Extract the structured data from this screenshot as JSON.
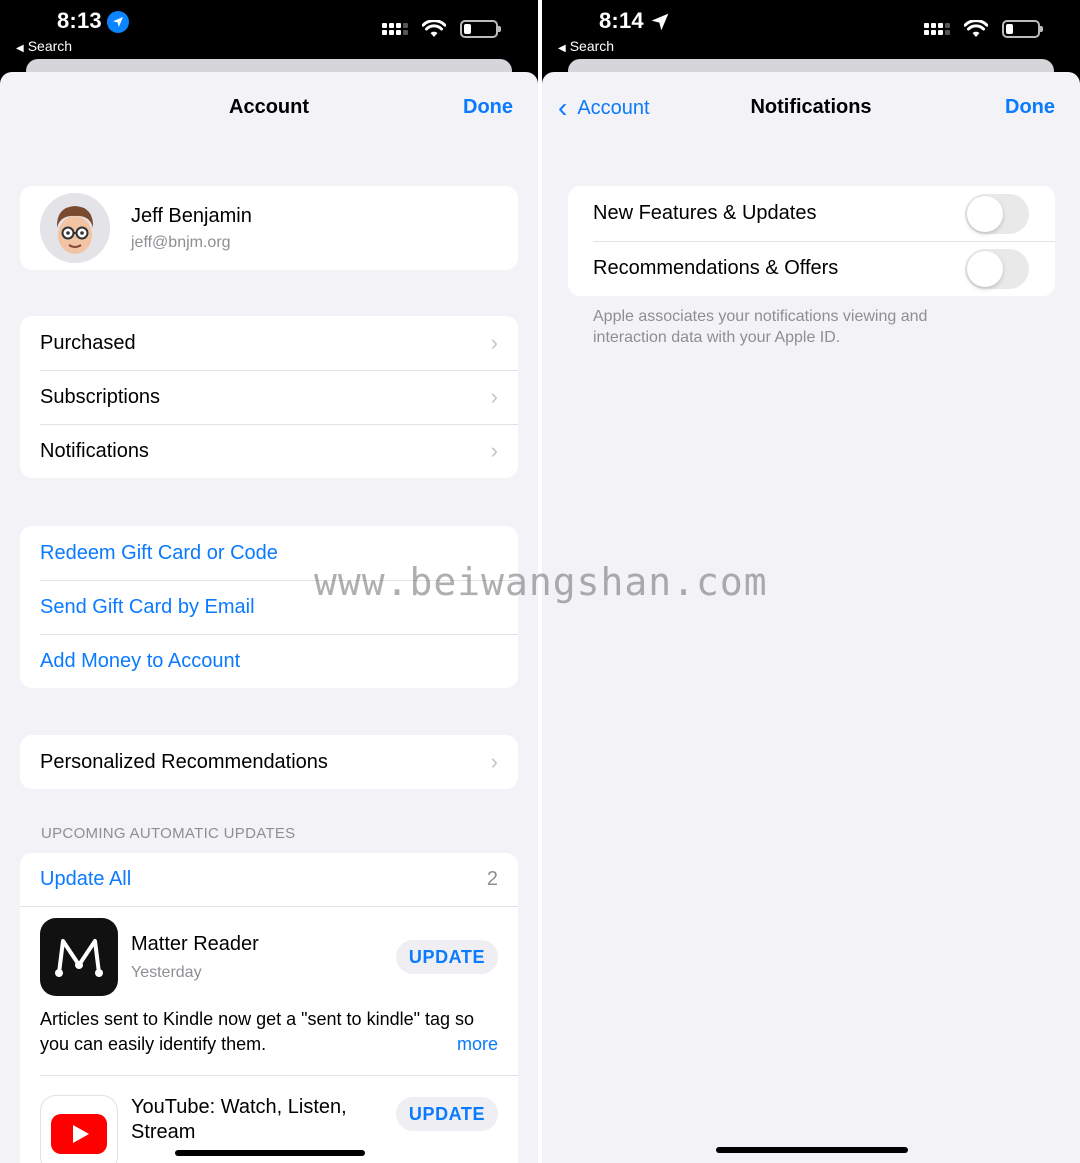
{
  "left_screen": {
    "status": {
      "time": "8:13",
      "back_label": "Search"
    },
    "nav": {
      "title": "Account",
      "done": "Done"
    },
    "profile": {
      "name": "Jeff Benjamin",
      "email": "jeff@bnjm.org"
    },
    "menu": [
      "Purchased",
      "Subscriptions",
      "Notifications"
    ],
    "gift_links": [
      "Redeem Gift Card or Code",
      "Send Gift Card by Email",
      "Add Money to Account"
    ],
    "personalized": "Personalized Recommendations",
    "updates": {
      "header": "UPCOMING AUTOMATIC UPDATES",
      "update_all": "Update All",
      "count": "2",
      "apps": [
        {
          "name": "Matter Reader",
          "date": "Yesterday",
          "button": "UPDATE",
          "notes": "Articles sent to Kindle now get a \"sent to kindle\" tag so you can easily identify them.",
          "more": "more"
        },
        {
          "name": "YouTube: Watch, Listen, Stream",
          "button": "UPDATE"
        }
      ]
    }
  },
  "right_screen": {
    "status": {
      "time": "8:14",
      "back_label": "Search"
    },
    "nav": {
      "back": "Account",
      "title": "Notifications",
      "done": "Done"
    },
    "toggles": [
      {
        "label": "New Features & Updates",
        "on": false
      },
      {
        "label": "Recommendations & Offers",
        "on": false
      }
    ],
    "footer": "Apple associates your notifications viewing and interaction data with your Apple ID."
  },
  "watermark": "www.beiwangshan.com",
  "colors": {
    "accent": "#0a7aff",
    "background": "#f2f2f7",
    "secondary_text": "#8e8e93"
  }
}
